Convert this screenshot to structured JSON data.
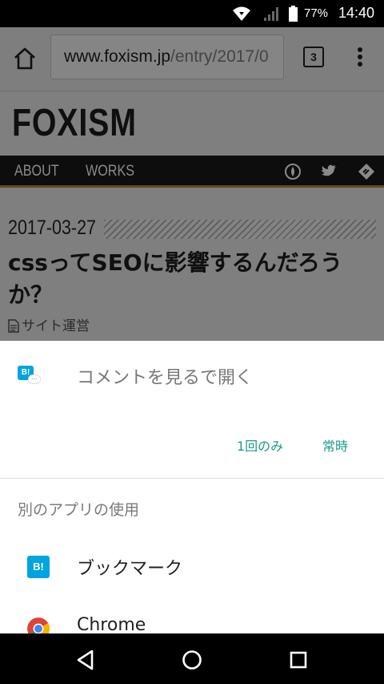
{
  "status_bar": {
    "battery": "77%",
    "time": "14:40"
  },
  "browser": {
    "url_host": "www.foxism.jp",
    "url_path": "/entry/2017/0",
    "tab_count": "3"
  },
  "site": {
    "logo": "FOXISM",
    "nav": [
      "ABOUT",
      "WORKS"
    ],
    "post": {
      "date": "2017-03-27",
      "title": "cssってSEOに影響するんだろうか？",
      "category": "サイト運営"
    }
  },
  "chooser": {
    "open_with": "コメントを見るで開く",
    "just_once": "1回のみ",
    "always": "常時",
    "other_apps": "別のアプリの使用",
    "apps": [
      {
        "label": "ブックマーク",
        "icon": "hatena-bookmark-icon"
      },
      {
        "label": "Chrome",
        "icon": "chrome-icon"
      }
    ],
    "hatena_glyph": "B!"
  },
  "colors": {
    "accent": "#1e9a88",
    "hatena": "#00a4de"
  }
}
